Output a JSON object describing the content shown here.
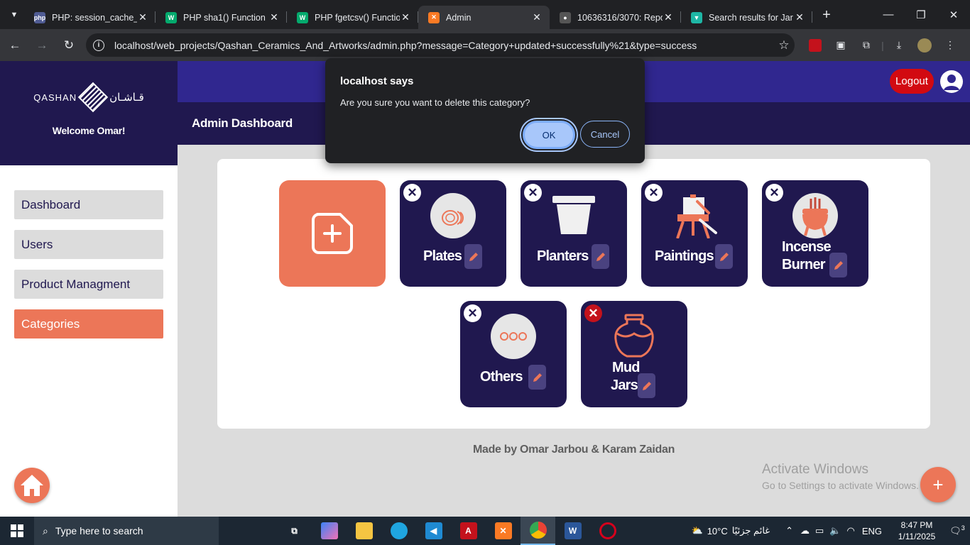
{
  "browser": {
    "tabs": [
      {
        "title": "PHP: session_cache_e",
        "icon": "php-icon",
        "color": "#4f5b93"
      },
      {
        "title": "PHP sha1() Function",
        "icon": "w3schools-icon",
        "color": "#04aa6d"
      },
      {
        "title": "PHP fgetcsv() Functio",
        "icon": "w3schools-icon",
        "color": "#04aa6d"
      },
      {
        "title": "Admin",
        "icon": "xampp-icon",
        "color": "#fb7a24",
        "active": true
      },
      {
        "title": "10636316/3070: Repo",
        "icon": "github-icon",
        "color": "#888888"
      },
      {
        "title": "Search results for Jar",
        "icon": "vercel-icon",
        "color": "#1eb6a5"
      }
    ],
    "url": "localhost/web_projects/Qashan_Ceramics_And_Artworks/admin.php?message=Category+updated+successfully%21&type=success"
  },
  "sidebar": {
    "logo_en": "QASHAN",
    "logo_ar": "قـاشـان",
    "welcome": "Welcome Omar!",
    "items": [
      {
        "label": "Dashboard",
        "active": false
      },
      {
        "label": "Users",
        "active": false
      },
      {
        "label": "Product Managment",
        "active": false
      },
      {
        "label": "Categories",
        "active": true
      }
    ]
  },
  "header": {
    "logout": "Logout",
    "title": "Admin Dashboard"
  },
  "categories": [
    {
      "name": "Plates",
      "icon": "plates-icon"
    },
    {
      "name": "Planters",
      "icon": "planter-icon"
    },
    {
      "name": "Paintings",
      "icon": "easel-icon"
    },
    {
      "name": "Incense Burner",
      "line1": "Incense",
      "line2": "Burner",
      "icon": "incense-icon"
    },
    {
      "name": "Others",
      "icon": "dots-icon"
    },
    {
      "name": "Mud Jars",
      "line1": "Mud",
      "line2": "Jars",
      "icon": "jar-icon"
    }
  ],
  "footer": "Made by Omar Jarbou & Karam Zaidan",
  "watermark": {
    "line1": "Activate Windows",
    "line2": "Go to Settings to activate Windows."
  },
  "dialog": {
    "title": "localhost says",
    "message": "Are you sure you want to delete this category?",
    "ok": "OK",
    "cancel": "Cancel"
  },
  "taskbar": {
    "search_placeholder": "Type here to search",
    "weather": "10°C",
    "weather_text": "غائم جزئيًا",
    "language": "ENG",
    "time": "8:47 PM",
    "date": "1/11/2025",
    "notifications": "3"
  },
  "colors": {
    "navy": "#20184f",
    "indigo": "#30278f",
    "accent": "#ec7658",
    "danger": "#d20a11"
  }
}
